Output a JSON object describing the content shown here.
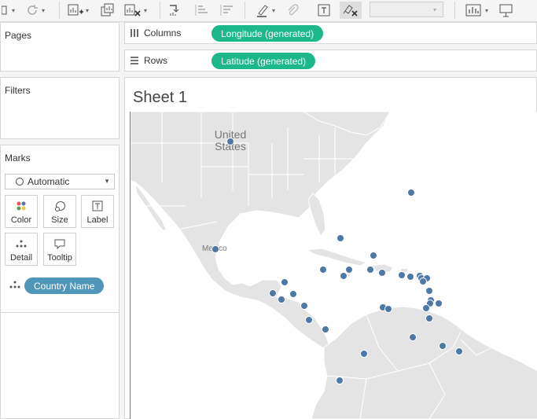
{
  "shelves": {
    "columns": {
      "label": "Columns",
      "pill": "Longitude (generated)"
    },
    "rows": {
      "label": "Rows",
      "pill": "Latitude (generated)"
    }
  },
  "panels": {
    "pages": "Pages",
    "filters": "Filters",
    "marks": "Marks"
  },
  "marks": {
    "type": "Automatic",
    "buttons": {
      "color": "Color",
      "size": "Size",
      "label": "Label",
      "detail": "Detail",
      "tooltip": "Tooltip"
    },
    "detail_field": "Country Name"
  },
  "sheet": {
    "title": "Sheet 1"
  },
  "map": {
    "labels": {
      "united_states": "United States",
      "mexico": "Mexico"
    },
    "mark_color": "#4e79a7",
    "pill_color": "#1db88a"
  }
}
